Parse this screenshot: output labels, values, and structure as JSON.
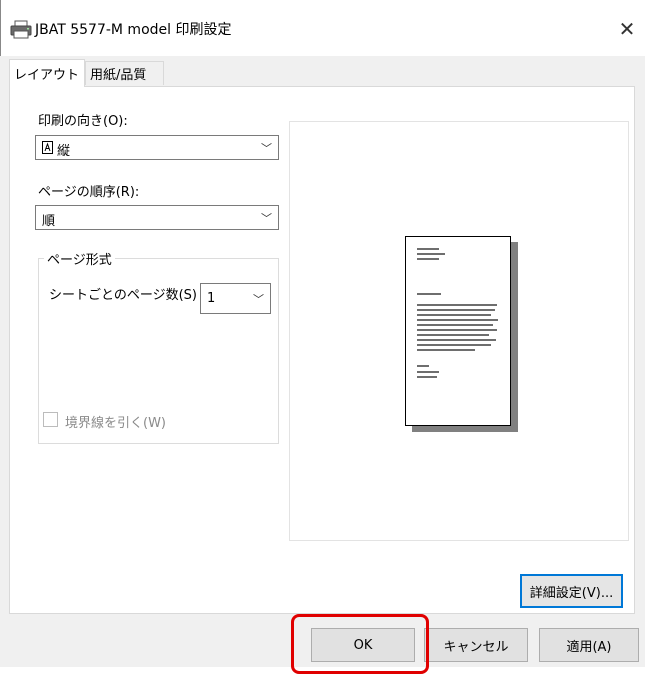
{
  "window": {
    "title": "JBAT 5577-M model 印刷設定",
    "close_glyph": "✕"
  },
  "tabs": [
    {
      "label": "レイアウト",
      "selected": true
    },
    {
      "label": "用紙/品質",
      "selected": false
    }
  ],
  "orientation": {
    "label": "印刷の向き(O):",
    "value": "縦",
    "icon": "portrait-page-icon"
  },
  "page_order": {
    "label": "ページの順序(R):",
    "value": "順"
  },
  "page_format": {
    "group_label": "ページ形式",
    "pages_per_sheet_label": "シートごとのページ数(S)",
    "pages_per_sheet_value": "1",
    "draw_borders_label": "境界線を引く(W)",
    "draw_borders_checked": false,
    "draw_borders_enabled": false
  },
  "buttons": {
    "advanced": "詳細設定(V)...",
    "ok": "OK",
    "cancel": "キャンセル",
    "apply": "適用(A)"
  },
  "colors": {
    "dialog_bg": "#f0f0f0",
    "focus_blue": "#0078d7",
    "highlight_red": "#e00000"
  }
}
